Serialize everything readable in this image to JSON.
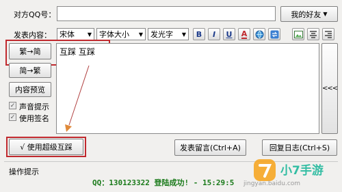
{
  "qq_label": "对方QQ号：",
  "qq_input_value": "",
  "my_friends_button": "我的好友",
  "publish_label": "发表内容：",
  "font_select": "宋体",
  "size_select": "字体大小",
  "effect_select": "发光字",
  "toolbar": {
    "bold": "B",
    "italic": "I",
    "underline": "U",
    "color": "A"
  },
  "side_buttons": {
    "trad_to_simp": "繁→简",
    "simp_to_trad": "简→繁",
    "preview": "内容预览"
  },
  "checkboxes": {
    "sound": "声音提示",
    "signature": "使用签名"
  },
  "editor_text": "互踩 互踩",
  "collapse_glyph": "<<<",
  "super_button": "√ 使用超级互踩",
  "post_button": "发表留言(Ctrl+A)",
  "reply_button": "回复日志(Ctrl+S)",
  "tips_label": "操作提示",
  "status_text": "QQ：130123322 登陆成功! - 15:29:5",
  "watermark": {
    "logo": "小7手游",
    "site": "jingyan.baidu.com"
  },
  "colors": {
    "highlight_red": "#c0282d",
    "status_green": "#1a7a1a"
  }
}
